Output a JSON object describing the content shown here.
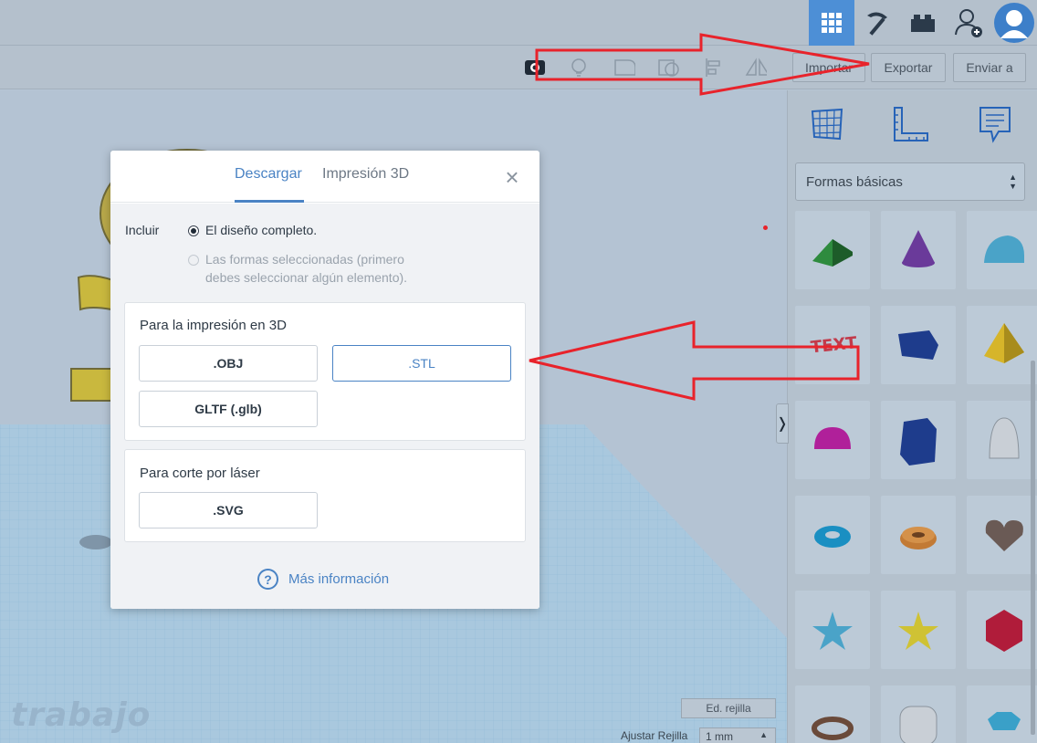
{
  "toolbar": {
    "import_label": "Importar",
    "export_label": "Exportar",
    "send_label": "Enviar a"
  },
  "workspace": {
    "watermark": "trabajo",
    "edit_grid_label": "Ed. rejilla",
    "snap_grid_label": "Ajustar Rejilla",
    "snap_grid_value": "1 mm"
  },
  "right_panel": {
    "category_select": "Formas básicas",
    "shapes": [
      {
        "name": "roof-shape",
        "color": "#2e8b3e"
      },
      {
        "name": "cone-shape",
        "color": "#6a3a9a"
      },
      {
        "name": "round-roof-shape",
        "color": "#4aa3c8"
      },
      {
        "name": "text-shape",
        "color": "#c23a4a"
      },
      {
        "name": "polygon-shape",
        "color": "#1e3c8c"
      },
      {
        "name": "pyramid-shape",
        "color": "#d6b52a"
      },
      {
        "name": "half-sphere-shape",
        "color": "#b0209a"
      },
      {
        "name": "polygon-prism-shape",
        "color": "#1e3c8c"
      },
      {
        "name": "paraboloid-shape",
        "color": "#c9cfd6"
      },
      {
        "name": "torus-shape",
        "color": "#1a8fc2"
      },
      {
        "name": "tube-shape",
        "color": "#c27a35"
      },
      {
        "name": "heart-shape",
        "color": "#6a5a55"
      },
      {
        "name": "star-shape",
        "color": "#4aa3c8"
      },
      {
        "name": "star-yellow-shape",
        "color": "#cfc234"
      },
      {
        "name": "icosahedron-shape",
        "color": "#b01c3a"
      },
      {
        "name": "ring-shape",
        "color": "#6a4a3a"
      },
      {
        "name": "rounded-box-shape",
        "color": "#c9cfd6"
      },
      {
        "name": "gem-shape",
        "color": "#3aa0c8"
      }
    ]
  },
  "dialog": {
    "tab_download": "Descargar",
    "tab_print3d": "Impresión 3D",
    "close_glyph": "×",
    "include_label": "Incluir",
    "option_full": "El diseño completo.",
    "option_selected_line1": "Las formas seleccionadas (primero",
    "option_selected_line2": "debes seleccionar algún elemento).",
    "print_section_title": "Para la impresión en 3D",
    "obj_label": ".OBJ",
    "stl_label": ".STL",
    "gltf_label": "GLTF (.glb)",
    "laser_section_title": "Para corte por láser",
    "svg_label": ".SVG",
    "help_icon_glyph": "?",
    "more_info_label": "Más información"
  },
  "colors": {
    "accent": "#4a83c4",
    "annotation_red": "#e8232b"
  }
}
